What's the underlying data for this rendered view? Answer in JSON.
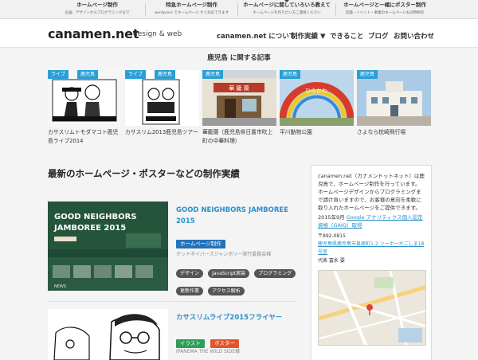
{
  "topnav": [
    {
      "title": "ホームページ制作",
      "sub": "企画、デザインからプログラミングまで"
    },
    {
      "title": "特急ホームページ制作",
      "sub": "wordpress でホームページ すぐ対応できます"
    },
    {
      "title": "ホームページに関していろいろ教えて",
      "sub": "ホームページを作りたい方ご連絡ください"
    },
    {
      "title": "ホームページと一緒にポスター制作",
      "sub": "店舗・イベント・事業のホームページも同時制作"
    }
  ],
  "header": {
    "logo": "canamen.net",
    "logo_sub": "design & web",
    "nav": [
      "canamen.net について",
      "制作実績 ▼",
      "できること",
      "ブログ",
      "お問い合わせ"
    ]
  },
  "related": {
    "title": "鹿児島 に関する記事",
    "cards": [
      {
        "tag": "ライブ",
        "tag2": "鹿児島",
        "caption": "カサスリムトモダマコト鹿児島ライブ2014"
      },
      {
        "tag": "ライブ",
        "tag2": "鹿児島",
        "caption": "カサスリム2013鹿児島ツアー"
      },
      {
        "tag": "鹿児島",
        "caption": "華籠蘭（鹿児島県日置市吹上町の中華料理）"
      },
      {
        "tag": "鹿児島",
        "caption": "平川動物公園"
      },
      {
        "tag": "鹿児島",
        "caption": "さよなら枕崎飛行場"
      }
    ]
  },
  "main": {
    "heading": "最新のホームページ・ポスターなどの制作実績",
    "works": [
      {
        "title": "GOOD NEIGHBORS JAMBOREE 2015",
        "badges": [
          "ホームページ制作"
        ],
        "client": "グッドネイバーズジャンボリー実行委員会様",
        "tags": [
          "デザイン",
          "JavaScript実装",
          "プログラミング",
          "更新作業",
          "アクセス解析"
        ],
        "poster_text": "GOOD NEIGHBORS\nJAMBOREE 2015",
        "news": "NEWS"
      },
      {
        "title": "カサスリムライブ2015フライヤー",
        "badges": [
          "イラスト",
          "ポスター"
        ],
        "client": "IPANEMA THE WILD SIDE様"
      }
    ]
  },
  "sidebar": {
    "intro": "canamen.net（カナメンドットネット）は鹿児島で、ホームページ制作を行っています。ホームページデザインからプログラミングまで請け負いますので、お客様の意向を柔軟に取り入れたホームページをご提供できます。",
    "p2_prefix": "2015年9月 ",
    "p2_link": "Google アナリティクス個人認定資格（GAIQ）取得",
    "zip": "〒892-0815",
    "address": "鹿児島県鹿児島市易居町1-2 ソーホーかごしま18号室",
    "rep": "代表 冨永 要"
  },
  "colors": {
    "accent_blue": "#2a8fc9",
    "tag_blue": "#2a9fd6",
    "badge_blue": "#2572b8",
    "badge_green": "#2e9d57",
    "badge_orange": "#e0552b"
  }
}
